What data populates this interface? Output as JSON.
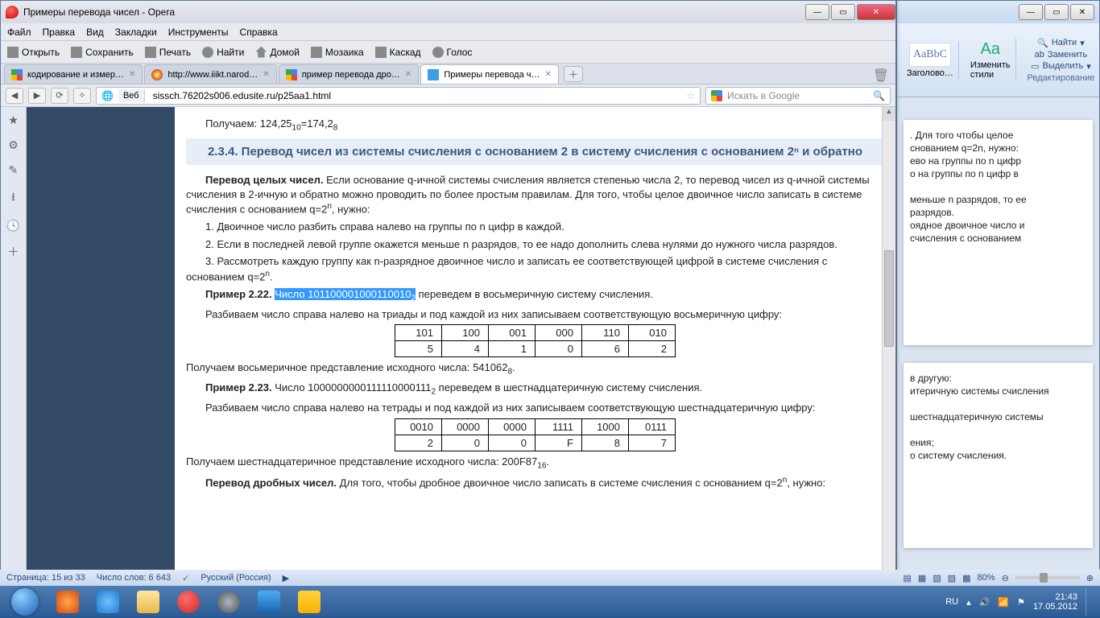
{
  "opera": {
    "title": "Примеры перевода чисел - Opera",
    "menu": [
      "Файл",
      "Правка",
      "Вид",
      "Закладки",
      "Инструменты",
      "Справка"
    ],
    "toolbar": {
      "open": "Открыть",
      "save": "Сохранить",
      "print": "Печать",
      "find": "Найти",
      "home": "Домой",
      "tile": "Мозаика",
      "cascade": "Каскад",
      "voice": "Голос"
    },
    "tabs": [
      {
        "label": "кодирование и измер…",
        "fav": "g"
      },
      {
        "label": "http://www.iiikt.narod…",
        "fav": "o"
      },
      {
        "label": "пример перевода дро…",
        "fav": "g"
      },
      {
        "label": "Примеры перевода ч…",
        "fav": "e",
        "active": true
      }
    ],
    "addr": {
      "web": "Веб",
      "url": "sissch.76202s006.edusite.ru/p25aa1.html",
      "globe": "🌐"
    },
    "search": {
      "placeholder": "Искать в Google"
    },
    "status_icons": [
      "▤",
      "☁",
      "⋔",
      "🐞"
    ]
  },
  "page": {
    "first_line_a": "Получаем: 124,25",
    "first_line_b": "=174,2",
    "section": "2.3.4. Перевод чисел из системы счисления с основанием 2 в систему счисления с основанием 2ⁿ и обратно",
    "p1": "Перевод целых чисел. Если основание q-ичной системы счисления является степенью  числа 2, то  перевод  чисел из q-ичной системы счисления в 2-ичную и обратно можно проводить по более простым правилам. Для того, чтобы целое двоичное число записать в системе счисления с основанием q=2ⁿ, нужно:",
    "li1": "1. Двоичное число разбить справа налево на группы по n  цифр в каждой.",
    "li2": "2. Если в последней левой группе окажется меньше n разрядов, то ее надо дополнить слева нулями до нужного числа разрядов.",
    "li3": "3. Рассмотреть каждую группу как n-разрядное двоичное число и  записать ее соответствующей цифрой в системе счисления с основанием q=2ⁿ.",
    "ex22a": "Пример 2.22.",
    "ex22sel": "Число 101100001000110010",
    "ex22b": " переведем в восьмеричную систему счисления.",
    "p_triads": "Разбиваем число справа налево на триады и под каждой из них записываем соответствующую восьмеричную цифру:",
    "table1": {
      "r1": [
        "101",
        "100",
        "001",
        "000",
        "110",
        "010"
      ],
      "r2": [
        "5",
        "4",
        "1",
        "0",
        "6",
        "2"
      ]
    },
    "oct_res_a": "Получаем восьмеричное представление исходного числа: 541062",
    "ex23a": "Пример 2.23.",
    "ex23b": "  Число 1000000000111110000111",
    "ex23c": " переведем в шестнадцатеричную систему счисления.",
    "p_tetrads": "Разбиваем число  справа налево на тетрады и под каждой из них записываем соответствующую шестнадцатеричную цифру:",
    "table2": {
      "r1": [
        "0010",
        "0000",
        "0000",
        "1111",
        "1000",
        "0111"
      ],
      "r2": [
        "2",
        "0",
        "0",
        "F",
        "8",
        "7"
      ]
    },
    "hex_res_a": "Получаем шестнадцатеричное   представление   исходного   числа: 200F87",
    "p_frac": "Перевод дробных чисел. Для  того,  чтобы  дробное двоичное число записать в системе счисления с основанием q=2ⁿ, нужно:"
  },
  "word": {
    "ribbon": {
      "style_preview": "AaBbC",
      "style_label": "Заголово…",
      "change_styles": "Изменить стили",
      "find": "Найти",
      "replace": "Заменить",
      "select": "Выделить",
      "group_edit": "Редактирование"
    },
    "doc1": [
      ". Для того чтобы целое",
      "снованием q=2n, нужно:",
      "ево на группы по n цифр",
      "о на группы по n цифр в",
      "меньше n разрядов, то ее",
      "разрядов.",
      "оядное двоичное число и",
      " счисления с основанием"
    ],
    "doc2": [
      "в другую:",
      "итеричную системы счисления",
      "шестнадцатеричную системы",
      "ения;",
      "о систему счисления."
    ],
    "status": {
      "page": "Страница: 15 из 33",
      "words": "Число слов: 6 643",
      "lang": "Русский (Россия)",
      "zoom": "80%"
    }
  },
  "taskbar": {
    "tray": {
      "lang": "RU",
      "time": "21:43",
      "date": "17.05.2012"
    }
  }
}
